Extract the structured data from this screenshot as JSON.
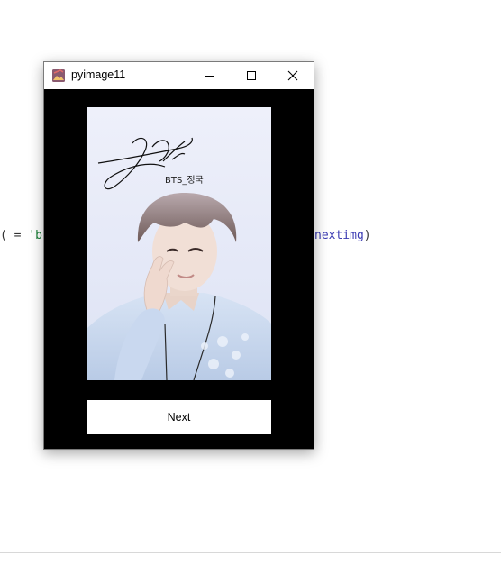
{
  "editor": {
    "fragment_left": {
      "punct": "( = ",
      "string": "'bl"
    },
    "fragment_right": {
      "ident": "nextimg",
      "punct": ")"
    }
  },
  "window": {
    "title": "pyimage11",
    "controls": [
      "minimize-icon",
      "maximize-icon",
      "close-icon"
    ]
  },
  "photo": {
    "signature_text": "BTS_정국",
    "description": "portrait photo with autograph"
  },
  "next_button": {
    "label": "Next"
  },
  "colors": {
    "window_background": "#000000",
    "titlebar": "#ffffff",
    "string": "#1a7f37",
    "identifier": "#3b3bb3"
  }
}
